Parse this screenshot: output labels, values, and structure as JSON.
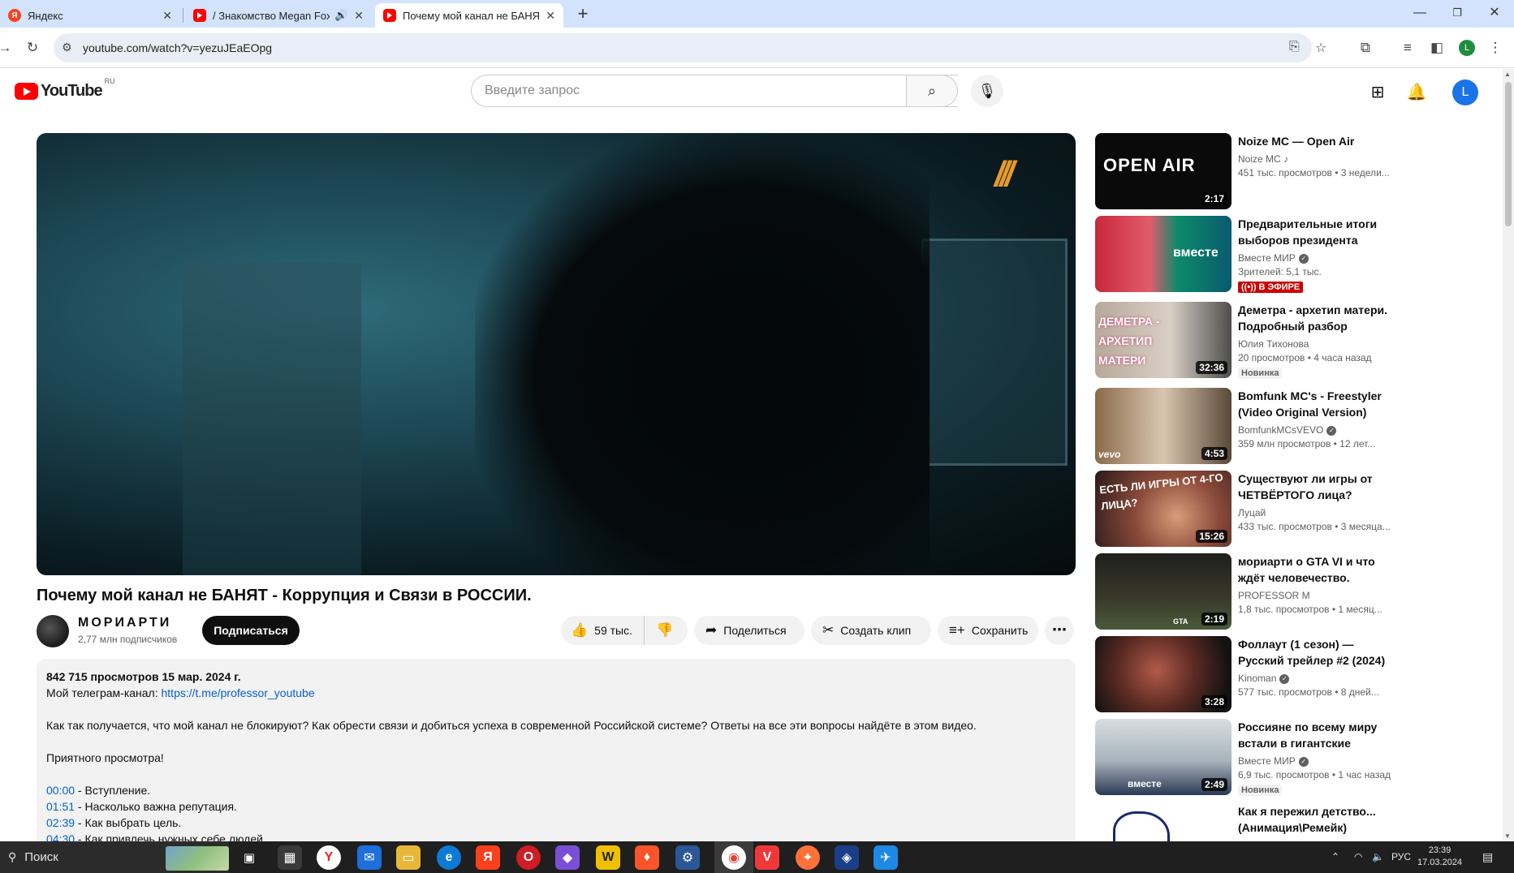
{
  "browser": {
    "tabs": [
      {
        "title": "Яндекс",
        "icon": "yandex-icon",
        "active": false
      },
      {
        "title": "/ Знакомство Megan Fox с",
        "icon": "youtube-icon",
        "active": false,
        "audio": true
      },
      {
        "title": "Почему мой канал не БАНЯТ -",
        "icon": "youtube-icon",
        "active": true
      }
    ],
    "url": "youtube.com/watch?v=yezuJEaEOpg",
    "profile_letter": "L"
  },
  "youtube": {
    "logo_text": "YouTube",
    "region": "RU",
    "search_placeholder": "Введите запрос",
    "avatar_letter": "L"
  },
  "video": {
    "title": "Почему мой канал не БАНЯТ - Коррупция и Связи в РОССИИ.",
    "channel": "МОРИАРТИ",
    "subscribers": "2,77 млн подписчиков",
    "subscribe_label": "Подписаться",
    "likes": "59 тыс.",
    "share_label": "Поделиться",
    "clip_label": "Создать клип",
    "save_label": "Сохранить",
    "views_date": "842 715 просмотров  15 мар. 2024 г.",
    "description": {
      "telegram_prefix": "Мой телеграм-канал: ",
      "telegram_link": "https://t.me/professor_youtube",
      "paragraph": "Как так получается, что мой канал не блокируют? Как обрести связи и добиться успеха в современной Российской системе? Ответы на все эти вопросы найдёте в этом видео.",
      "greeting": "Приятного просмотра!",
      "chapters": [
        {
          "time": "00:00",
          "text": " - Вступление."
        },
        {
          "time": "01:51",
          "text": " - Насколько важна репутация."
        },
        {
          "time": "02:39",
          "text": " - Как выбрать цель."
        },
        {
          "time": "04:30",
          "text": " - Как привлечь нужных себе людей"
        }
      ]
    }
  },
  "recommendations": [
    {
      "title": "Noize MC — Open Air",
      "channel": "Noize MC",
      "channel_mark": "♪",
      "meta": "451 тыс. просмотров  •  3 недели...",
      "duration": "2:17",
      "thumb_text": "OPEN AIR"
    },
    {
      "title": "Предварительные итоги выборов президента России...",
      "channel": "Вместе МИР",
      "verified": true,
      "meta": "Зрителей: 5,1 тыс.",
      "live_label": "((•)) В ЭФИРЕ",
      "thumb_text": "вместе"
    },
    {
      "title": "Деметра - архетип матери. Подробный разбор влияния...",
      "channel": "Юлия Тихонова",
      "meta": "20 просмотров  •  4 часа назад",
      "badge": "Новинка",
      "duration": "32:36",
      "thumb_text": "ДЕМЕТРА - АРХЕТИП МАТЕРИ"
    },
    {
      "title": "Bomfunk MC's - Freestyler (Video Original Version)",
      "channel": "BomfunkMCsVEVO",
      "verified": true,
      "meta": "359 млн просмотров  •  12 лет...",
      "duration": "4:53",
      "thumb_text": "vevo"
    },
    {
      "title": "Существуют ли игры от ЧЕТВЁРТОГО лица?",
      "channel": "Луцай",
      "meta": "433 тыс. просмотров  •  3 месяца...",
      "duration": "15:26",
      "thumb_text": "ЕСТЬ ЛИ ИГРЫ ОТ 4-ГО ЛИЦА?"
    },
    {
      "title": "мориарти о GTA VI и что ждёт человечество.",
      "channel": "PROFESSOR M",
      "meta": "1,8 тыс. просмотров  •  1 месяц...",
      "duration": "2:19",
      "thumb_text": "GTA"
    },
    {
      "title": "Фоллаут (1 сезон) — Русский трейлер #2 (2024)",
      "channel": "Kinoman",
      "verified": true,
      "meta": "577 тыс. просмотров  •  8 дней...",
      "duration": "3:28",
      "thumb_text": ""
    },
    {
      "title": "Россияне по всему миру встали в гигантские очереди...",
      "channel": "Вместе МИР",
      "verified": true,
      "meta": "6,9 тыс. просмотров  •  1 час назад",
      "badge": "Новинка",
      "duration": "2:49",
      "thumb_text": "вместе"
    },
    {
      "title": "Как я пережил детство... (Анимация\\Ремейк)",
      "channel": "",
      "meta": "",
      "duration": "",
      "thumb_text": ""
    }
  ],
  "taskbar": {
    "search_label": "Поиск",
    "language": "РУС",
    "time": "23:39",
    "date": "17.03.2024"
  }
}
